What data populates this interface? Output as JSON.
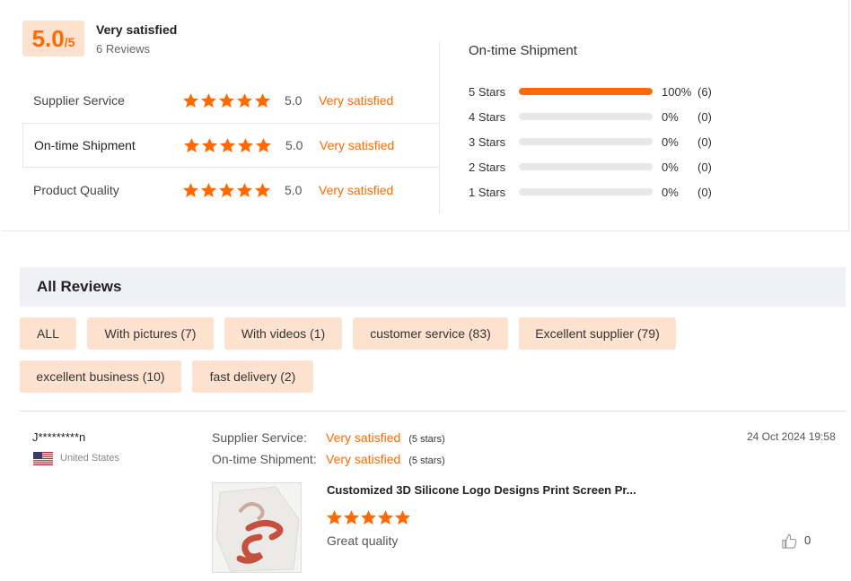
{
  "summary": {
    "score": "5.0",
    "score_max": "/5",
    "overall_label": "Very satisfied",
    "review_count": "6 Reviews",
    "accent_color": "#ff6a00",
    "dimensions": [
      {
        "label": "Supplier Service",
        "rating": 5,
        "score": "5.0",
        "word": "Very satisfied"
      },
      {
        "label": "On-time Shipment",
        "rating": 5,
        "score": "5.0",
        "word": "Very satisfied"
      },
      {
        "label": "Product Quality",
        "rating": 5,
        "score": "5.0",
        "word": "Very satisfied"
      }
    ]
  },
  "distribution": {
    "title": "On-time Shipment",
    "rows": [
      {
        "label": "5  Stars",
        "fraction": 1.0,
        "percent": "100%",
        "count": "(6)"
      },
      {
        "label": "4  Stars",
        "fraction": 0,
        "percent": "0%",
        "count": "(0)"
      },
      {
        "label": "3  Stars",
        "fraction": 0,
        "percent": "0%",
        "count": "(0)"
      },
      {
        "label": "2  Stars",
        "fraction": 0,
        "percent": "0%",
        "count": "(0)"
      },
      {
        "label": "1  Stars",
        "fraction": 0,
        "percent": "0%",
        "count": "(0)"
      }
    ]
  },
  "reviews_header": "All Reviews",
  "tags": [
    "ALL",
    "With pictures (7)",
    "With videos (1)",
    "customer service (83)",
    "Excellent supplier (79)",
    "excellent business (10)",
    "fast delivery (2)"
  ],
  "review": {
    "reviewer": "J*********n",
    "country": "United States",
    "date": "24 Oct 2024 19:58",
    "meta": [
      {
        "label": "Supplier Service:",
        "value": "Very satisfied",
        "stars": "(5 stars)"
      },
      {
        "label": "On-time Shipment:",
        "value": "Very satisfied",
        "stars": "(5 stars)"
      }
    ],
    "product_title": "Customized 3D Silicone Logo Designs Print Screen Pr...",
    "rating": 5,
    "text": "Great quality",
    "likes": "0"
  }
}
